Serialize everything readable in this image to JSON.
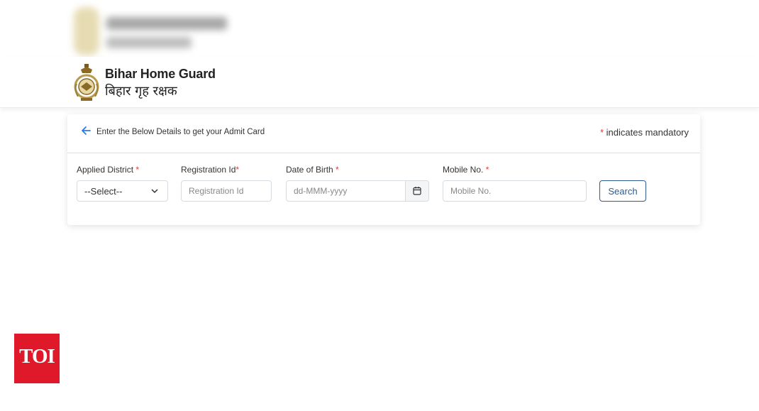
{
  "header": {
    "title": "Bihar Home Guard",
    "subtitle": "बिहार गृह रक्षक",
    "emblem_icon": "home-guard-emblem-icon"
  },
  "card": {
    "heading": "Enter the Below Details to get your Admit Card",
    "back_icon": "arrow-left-icon",
    "mandatory_star": "*",
    "mandatory_text": " indicates mandatory"
  },
  "form": {
    "district": {
      "label": "Applied District ",
      "required": "*",
      "selected": "--Select--"
    },
    "registration": {
      "label": "Registration Id",
      "required": "*",
      "placeholder": "Registration Id"
    },
    "dob": {
      "label": "Date of Birth ",
      "required": "*",
      "placeholder": "dd-MMM-yyyy",
      "icon": "calendar-icon"
    },
    "mobile": {
      "label": "Mobile No. ",
      "required": "*",
      "placeholder": "Mobile No."
    },
    "search_label": "Search"
  },
  "watermark": {
    "text": "TOI"
  },
  "colors": {
    "accent": "#2d5b8f",
    "required": "#e03c3c",
    "link": "#2d7be0",
    "toi": "#e0192a"
  }
}
